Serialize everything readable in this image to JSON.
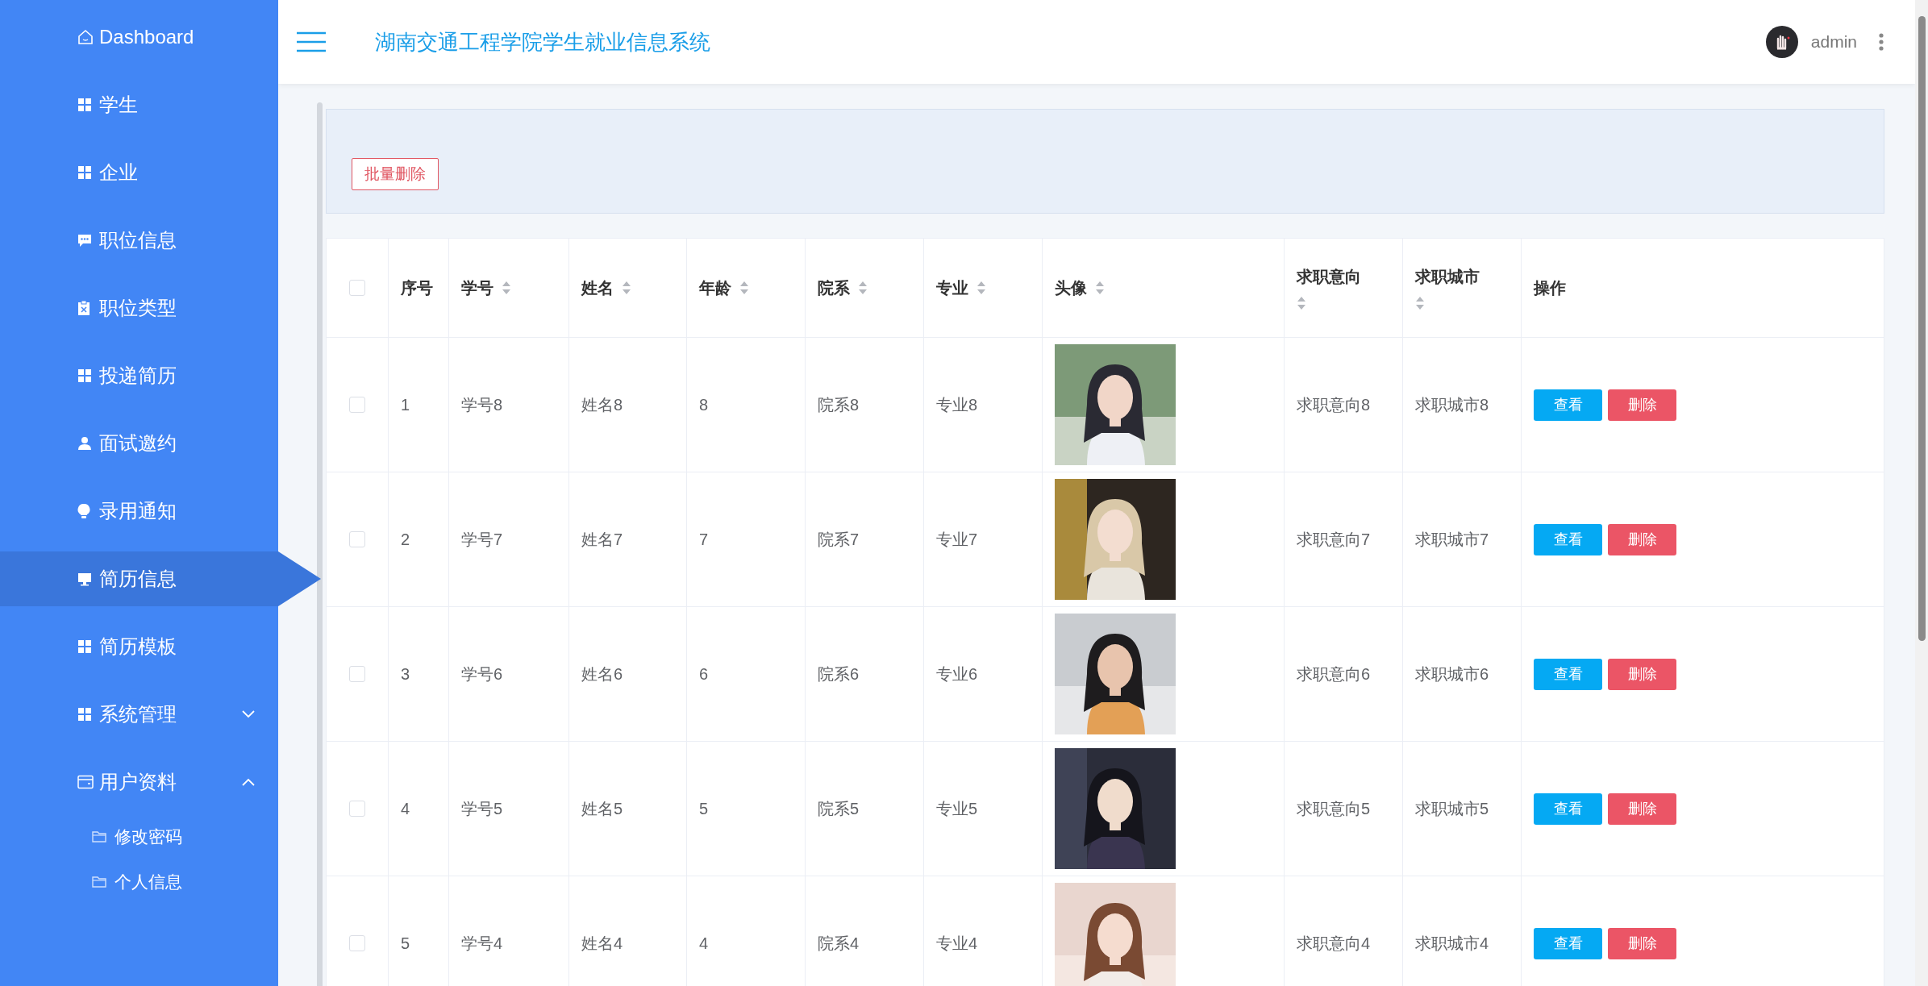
{
  "sidebar": {
    "items": [
      {
        "label": "Dashboard",
        "selected": false
      },
      {
        "label": "学生",
        "selected": false
      },
      {
        "label": "企业",
        "selected": false
      },
      {
        "label": "职位信息",
        "selected": false
      },
      {
        "label": "职位类型",
        "selected": false
      },
      {
        "label": "投递简历",
        "selected": false
      },
      {
        "label": "面试邀约",
        "selected": false
      },
      {
        "label": "录用通知",
        "selected": false
      },
      {
        "label": "简历信息",
        "selected": true
      },
      {
        "label": "简历模板",
        "selected": false
      },
      {
        "label": "系统管理",
        "selected": false,
        "expanded": false
      },
      {
        "label": "用户资料",
        "selected": false,
        "expanded": true,
        "children": [
          {
            "label": "修改密码",
            "selected": false
          },
          {
            "label": "个人信息",
            "selected": false
          }
        ]
      }
    ]
  },
  "header": {
    "title": "湖南交通工程学院学生就业信息系统",
    "user": "admin"
  },
  "toolbar": {
    "batch_delete": "批量删除"
  },
  "table": {
    "header_checked": false,
    "columns": [
      {
        "label": "序号",
        "kind": "text",
        "sortable": false
      },
      {
        "label": "学号",
        "kind": "text",
        "sortable": true
      },
      {
        "label": "姓名",
        "kind": "text",
        "sortable": true
      },
      {
        "label": "年龄",
        "kind": "text",
        "sortable": true
      },
      {
        "label": "院系",
        "kind": "text",
        "sortable": true
      },
      {
        "label": "专业",
        "kind": "text",
        "sortable": true
      },
      {
        "label": "头像",
        "kind": "picture",
        "sortable": true
      },
      {
        "label": "求职意向",
        "kind": "text",
        "sortable": true
      },
      {
        "label": "求职城市",
        "kind": "text",
        "sortable": true
      },
      {
        "label": "操作",
        "kind": "actions",
        "sortable": false
      }
    ],
    "rows": [
      {
        "checked": false,
        "cells": [
          "1",
          "学号8",
          "姓名8",
          "8",
          "院系8",
          "专业8",
          {
            "kind": "picture"
          },
          "求职意向8",
          "求职城市8"
        ],
        "actions": [
          {
            "label": "查看",
            "kind": "view"
          },
          {
            "label": "删除",
            "kind": "delete"
          }
        ]
      },
      {
        "checked": false,
        "cells": [
          "2",
          "学号7",
          "姓名7",
          "7",
          "院系7",
          "专业7",
          {
            "kind": "picture"
          },
          "求职意向7",
          "求职城市7"
        ],
        "actions": [
          {
            "label": "查看",
            "kind": "view"
          },
          {
            "label": "删除",
            "kind": "delete"
          }
        ]
      },
      {
        "checked": false,
        "cells": [
          "3",
          "学号6",
          "姓名6",
          "6",
          "院系6",
          "专业6",
          {
            "kind": "picture"
          },
          "求职意向6",
          "求职城市6"
        ],
        "actions": [
          {
            "label": "查看",
            "kind": "view"
          },
          {
            "label": "删除",
            "kind": "delete"
          }
        ]
      },
      {
        "checked": false,
        "cells": [
          "4",
          "学号5",
          "姓名5",
          "5",
          "院系5",
          "专业5",
          {
            "kind": "picture"
          },
          "求职意向5",
          "求职城市5"
        ],
        "actions": [
          {
            "label": "查看",
            "kind": "view"
          },
          {
            "label": "删除",
            "kind": "delete"
          }
        ]
      },
      {
        "checked": false,
        "cells": [
          "5",
          "学号4",
          "姓名4",
          "4",
          "院系4",
          "专业4",
          {
            "kind": "picture"
          },
          "求职意向4",
          "求职城市4"
        ],
        "actions": [
          {
            "label": "查看",
            "kind": "view"
          },
          {
            "label": "删除",
            "kind": "delete"
          }
        ]
      }
    ]
  }
}
